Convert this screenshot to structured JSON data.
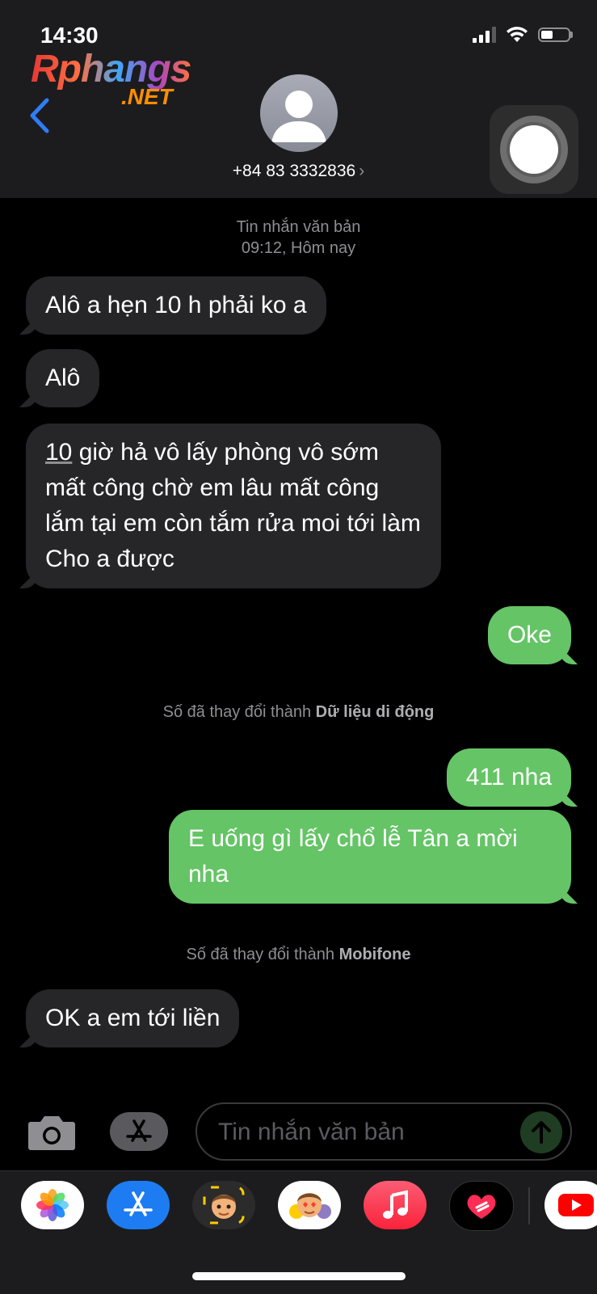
{
  "status": {
    "time": "14:30",
    "battery_percent": 45
  },
  "watermark": {
    "text": "Rphangs",
    "sub": ".NET"
  },
  "header": {
    "contact_number": "+84 83 3332836",
    "chevron": "›"
  },
  "thread": {
    "meta_label": "Tin nhắn văn bản",
    "meta_time": "09:12, Hôm nay",
    "notice1_prefix": "Số đã thay đổi thành",
    "notice1_value": "Dữ liệu di động",
    "notice2_prefix": "Số đã thay đổi thành",
    "notice2_value": "Mobifone"
  },
  "messages": [
    {
      "direction": "incoming",
      "text": "Alô a hẹn 10 h phải ko a"
    },
    {
      "direction": "incoming",
      "text": "Alô"
    },
    {
      "direction": "incoming",
      "text_prefix": "10",
      "text": " giờ hả vô lấy phòng vô sớm mất công chờ em lâu mất công lắm tại em còn tắm rửa moi tới làm Cho a được"
    },
    {
      "direction": "outgoing",
      "text": "Oke"
    },
    {
      "direction": "outgoing",
      "text": "411 nha"
    },
    {
      "direction": "outgoing",
      "text": "E uống gì lấy chổ lễ Tân a mời nha"
    },
    {
      "direction": "incoming",
      "text": "OK a em tới liền"
    }
  ],
  "composer": {
    "placeholder": "Tin nhắn văn bản"
  },
  "dock": {
    "apps": [
      "photos-icon",
      "app-store-icon",
      "memoji-camera-icon",
      "memoji-stickers-icon",
      "music-icon",
      "digital-touch-icon",
      "youtube-icon"
    ]
  },
  "colors": {
    "incoming_bubble": "#262628",
    "outgoing_bubble": "#65c466",
    "background": "#000000",
    "header": "#1c1c1e",
    "back_arrow": "#2f7cf6"
  }
}
